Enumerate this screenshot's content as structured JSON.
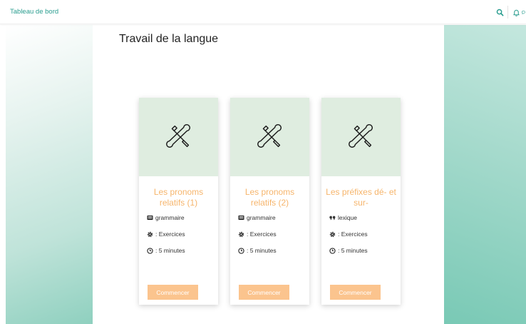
{
  "topbar": {
    "brand": "Tableau de bord",
    "icons": [
      "search-icon",
      "bell-icon",
      "chat-icon"
    ]
  },
  "main": {
    "title": "Travail de la langue"
  },
  "colors": {
    "accent": "#2a9d8f",
    "card_title": "#f6b56c",
    "button": "#fbc48e",
    "card_top": "#dfede0"
  },
  "cards": [
    {
      "title": "Les pronoms relatifs (1)",
      "category": "grammaire",
      "category_icon": "keyboard-icon",
      "type": ": Exercices",
      "duration": ": 5 minutes",
      "button": "Commencer",
      "image_icon": "tools-icon"
    },
    {
      "title": "Les pronoms relatifs (2)",
      "category": "grammaire",
      "category_icon": "keyboard-icon",
      "type": ": Exercices",
      "duration": ": 5 minutes",
      "button": "Commencer",
      "image_icon": "tools-icon"
    },
    {
      "title": "Les préfixes dé- et sur-",
      "category": "lexique",
      "category_icon": "quote-icon",
      "type": ": Exercices",
      "duration": ": 5 minutes",
      "button": "Commencer",
      "image_icon": "tools-icon"
    }
  ]
}
